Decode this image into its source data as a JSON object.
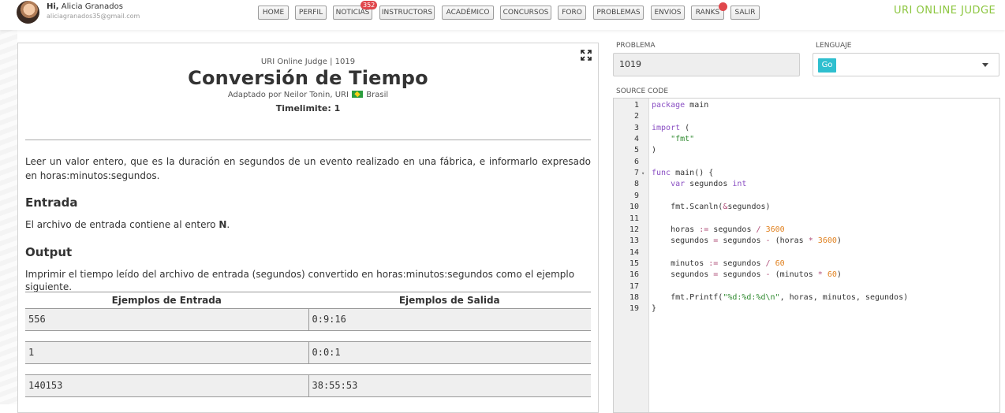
{
  "user": {
    "greeting_prefix": "Hi,",
    "name": "Alicia Granados",
    "email": "aliciagranados35@gmail.com"
  },
  "nav": {
    "items": [
      "HOME",
      "PERFIL",
      "NOTICIAS",
      "INSTRUCTORS",
      "ACADÉMICO",
      "CONCURSOS",
      "FORO",
      "PROBLEMAS",
      "ENVIOS",
      "RANKS",
      "SALIR"
    ],
    "notice_count": "352"
  },
  "brand": "URI ONLINE JUDGE",
  "problem": {
    "judge": "URI Online Judge | 1019",
    "title": "Conversión de Tiempo",
    "author_prefix": "Adaptado por Neilor Tonin, URI",
    "country": "Brasil",
    "timelimit": "Timelimite: 1",
    "description": "Leer un valor entero, que es la duración en segundos de un evento realizado en una fábrica, e informarlo expresado en horas:minutos:segundos.",
    "input_title": "Entrada",
    "input_text_prefix": "El archivo de entrada contiene al entero ",
    "input_text_bold": "N",
    "input_text_suffix": ".",
    "output_title": "Output",
    "output_text": "Imprimir el tiempo leído del archivo de entrada (segundos) convertido en horas:minutos:segundos como el ejemplo siguiente.",
    "examples_input_header": "Ejemplos de Entrada",
    "examples_output_header": "Ejemplos de Salida",
    "examples": [
      {
        "input": "556",
        "output": "0:9:16"
      },
      {
        "input": "1",
        "output": "0:0:1"
      },
      {
        "input": "140153",
        "output": "38:55:53"
      }
    ]
  },
  "form": {
    "problem_label": "PROBLEMA",
    "problem_value": "1019",
    "language_label": "LENGUAJE",
    "language_value": "Go",
    "source_label": "SOURCE CODE"
  },
  "code_lines": [
    "package main",
    "",
    "import (",
    "    \"fmt\"",
    ")",
    "",
    "func main() {",
    "    var segundos int",
    "",
    "    fmt.Scanln(&segundos)",
    "",
    "    horas := segundos / 3600",
    "    segundos = segundos - (horas * 3600)",
    "",
    "    minutos := segundos / 60",
    "    segundos = segundos - (minutos * 60)",
    "",
    "    fmt.Printf(\"%d:%d:%d\\n\", horas, minutos, segundos)",
    "}"
  ],
  "colors": {
    "brand": "#8cc63f",
    "badge": "#e0474c",
    "language_chip": "#2fbfcf",
    "keyword": "#8a4fc3",
    "string": "#2f8a2f",
    "number": "#e0801e"
  }
}
